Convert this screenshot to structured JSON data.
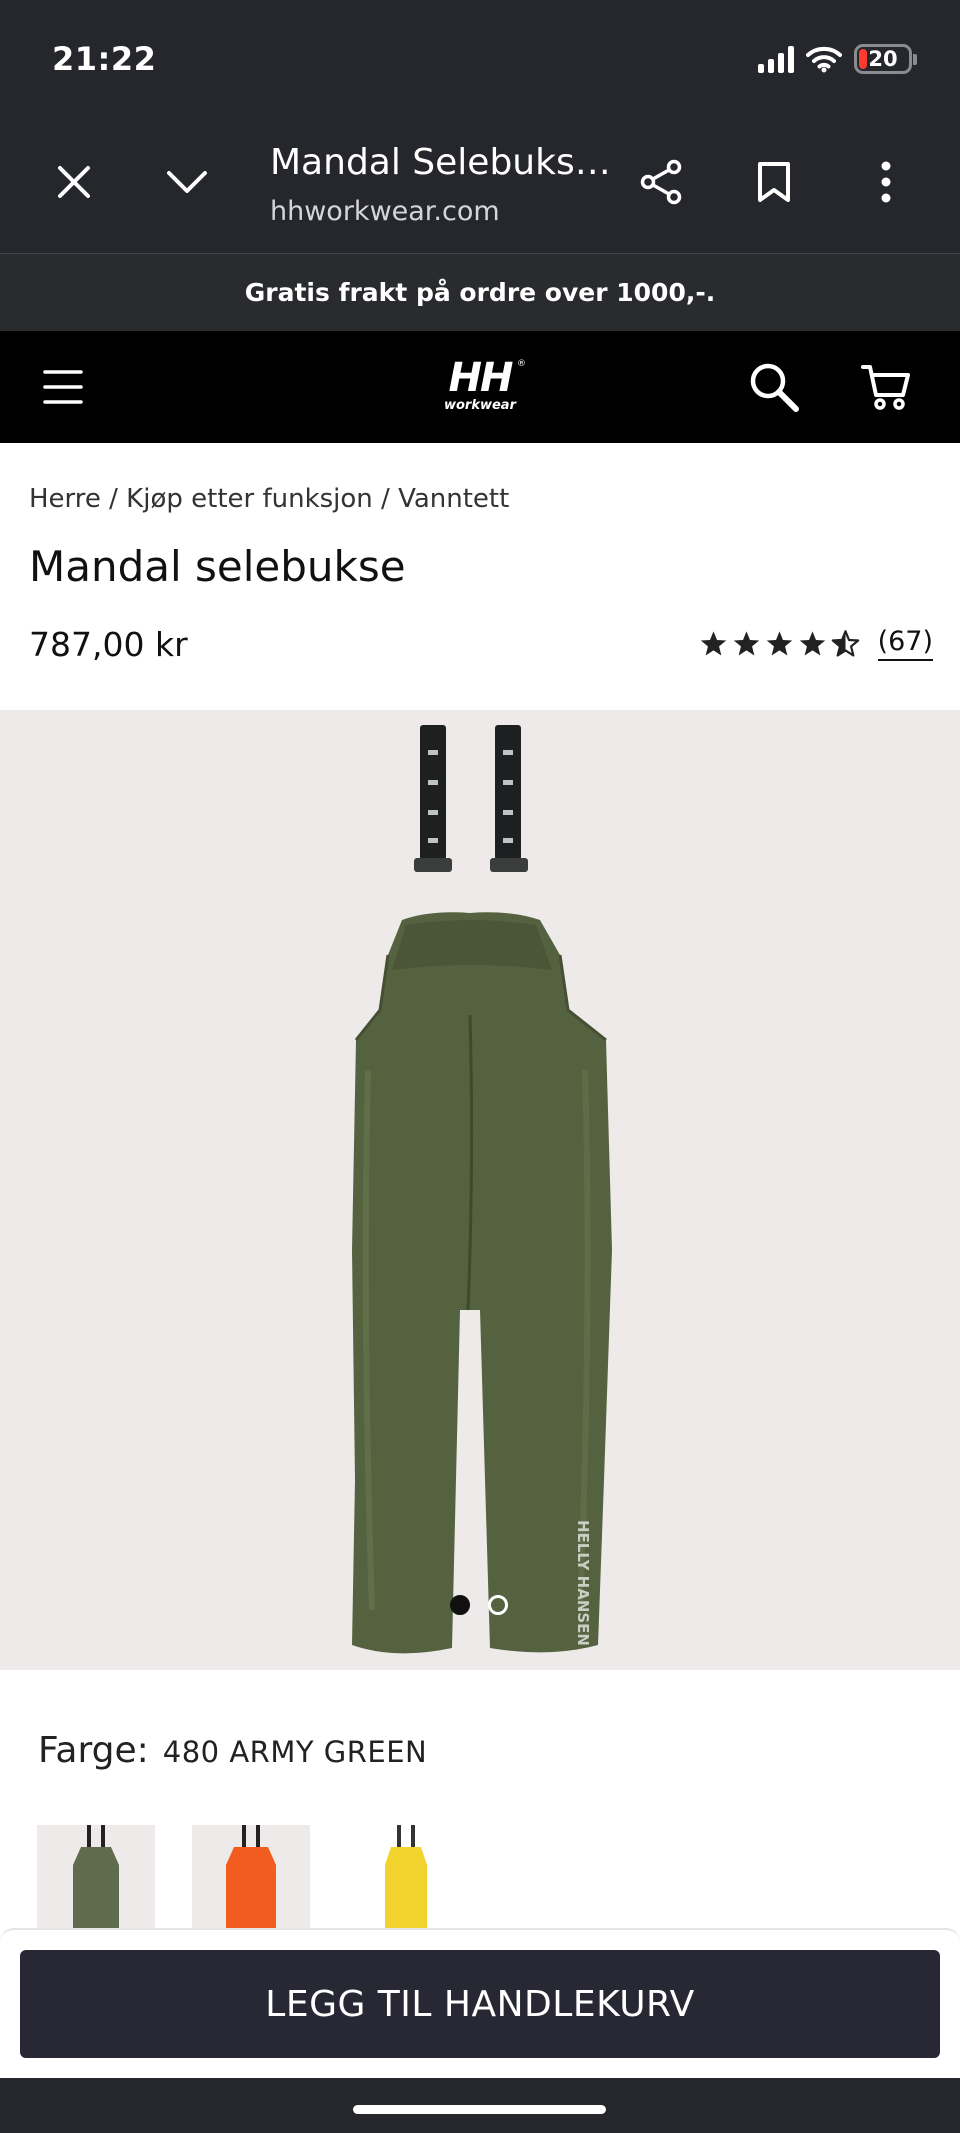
{
  "status_bar": {
    "time": "21:22",
    "battery": "20"
  },
  "browser": {
    "title": "Mandal Selebuks…",
    "domain": "hhworkwear.com"
  },
  "promo": {
    "text": "Gratis frakt på ordre over 1000,-."
  },
  "header": {
    "logo_main": "HH",
    "logo_sub": "workwear",
    "logo_reg": "®"
  },
  "product": {
    "breadcrumb": "Herre / Kjøp etter funksjon / Vanntett",
    "title": "Mandal selebukse",
    "price": "787,00 kr",
    "rating": 4.5,
    "review_count": "(67)"
  },
  "gallery": {
    "current_image": 1,
    "image_count": 2,
    "print_on_garment": "HELLY HANSEN"
  },
  "color": {
    "label": "Farge:",
    "value": "480 ARMY GREEN",
    "swatches": [
      "#5f6b4d",
      "#f25c1f",
      "#f2d22c"
    ]
  },
  "cart": {
    "button_label": "LEGG TIL HANDLEKURV"
  },
  "colors": {
    "chrome_bg": "#26272c",
    "header_bg": "#000000",
    "button_bg": "#272833",
    "image_bg": "#eeeaea"
  }
}
